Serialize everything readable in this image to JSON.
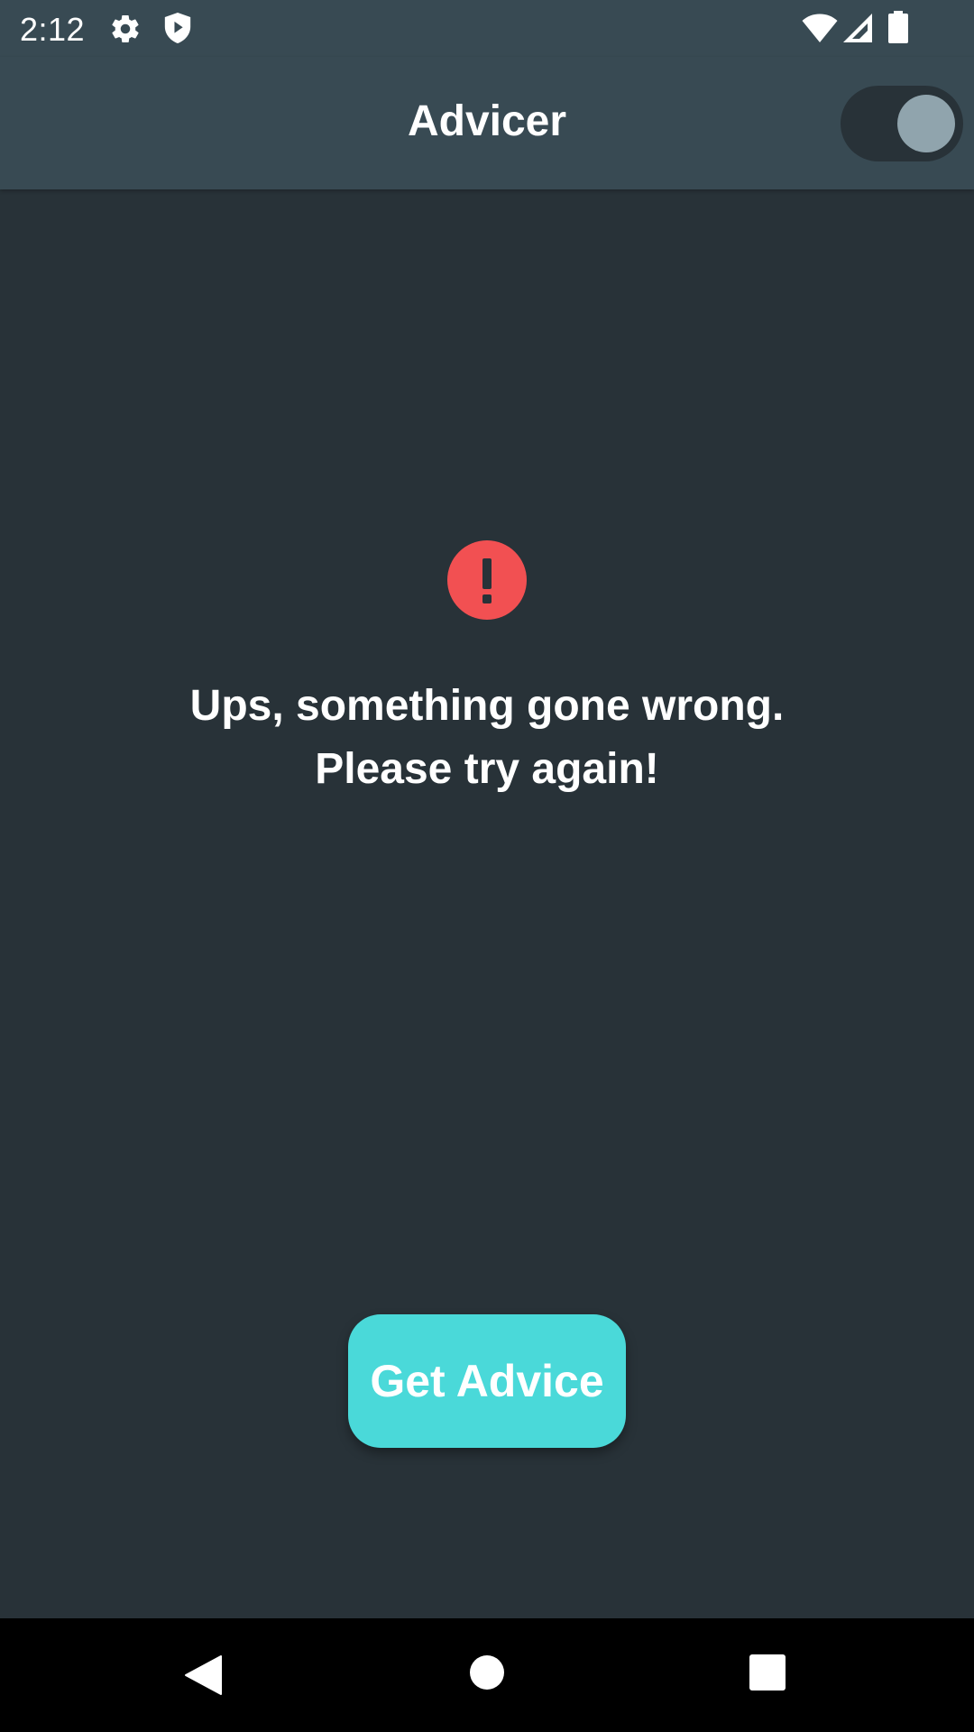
{
  "status_bar": {
    "time": "2:12",
    "icons": [
      "settings-icon",
      "shield-icon",
      "wifi-icon",
      "signal-icon",
      "battery-icon"
    ]
  },
  "app_bar": {
    "title": "Advicer",
    "theme_switch": {
      "checked": true
    }
  },
  "error": {
    "icon": "alert-circle-icon",
    "icon_color": "#f25052",
    "line1": "Ups, something gone wrong.",
    "line2": "Please try again!"
  },
  "actions": {
    "get_advice_label": "Get Advice",
    "accent_color": "#4ad9d9"
  },
  "nav_bar": {
    "buttons": [
      "back-icon",
      "home-icon",
      "recents-icon"
    ]
  }
}
